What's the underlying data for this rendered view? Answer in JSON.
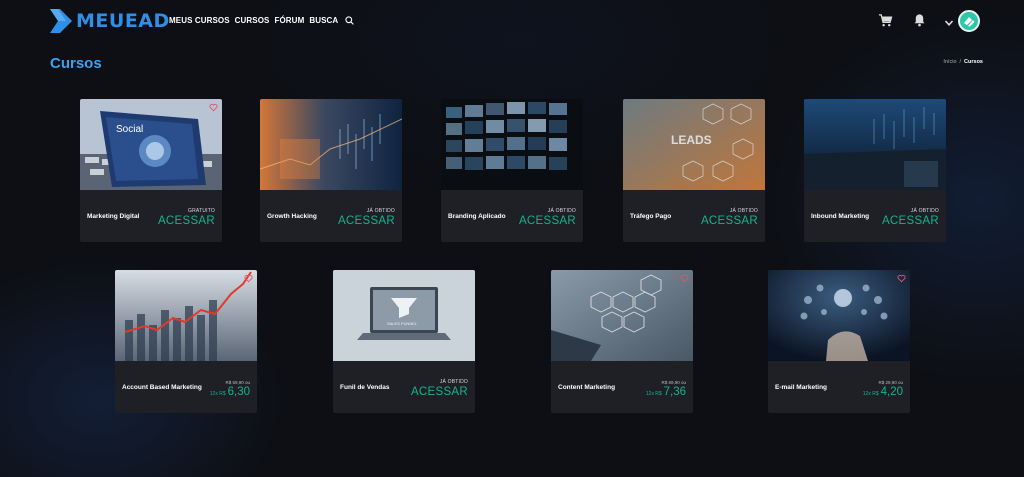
{
  "brand": {
    "name": "MEUEAD"
  },
  "nav": {
    "items": [
      "MEUS CURSOS",
      "CURSOS",
      "FÓRUM",
      "BUSCA"
    ]
  },
  "page": {
    "title": "Cursos",
    "breadcrumb": {
      "home": "Início",
      "separator": "/",
      "current": "Cursos"
    }
  },
  "colors": {
    "accent": "#3aa0f0",
    "green": "#15b38c",
    "card_bg": "#1e2026",
    "heart": "#e0566b"
  },
  "courses": [
    {
      "title": "Marketing Digital",
      "status": "GRATUITO",
      "action": "ACESSAR",
      "favorite": true
    },
    {
      "title": "Growth Hacking",
      "status": "JÁ OBTIDO",
      "action": "ACESSAR",
      "favorite": false
    },
    {
      "title": "Branding Aplicado",
      "status": "JÁ OBTIDO",
      "action": "ACESSAR",
      "favorite": false
    },
    {
      "title": "Tráfego Pago",
      "status": "JÁ OBTIDO",
      "action": "ACESSAR",
      "favorite": false
    },
    {
      "title": "Inbound Marketing",
      "status": "JÁ OBTIDO",
      "action": "ACESSAR",
      "favorite": false
    },
    {
      "title": "Account Based Marketing",
      "old_price": "R$ 59,90 ou",
      "installment_prefix": "12x R$",
      "installment_value": "6,30",
      "favorite": true
    },
    {
      "title": "Funil de Vendas",
      "status": "JÁ OBTIDO",
      "action": "ACESSAR",
      "favorite": false
    },
    {
      "title": "Content Marketing",
      "old_price": "R$ 69,90 ou",
      "installment_prefix": "12x R$",
      "installment_value": "7,36",
      "favorite": true
    },
    {
      "title": "E-mail Marketing",
      "old_price": "R$ 29,90 ou",
      "installment_prefix": "12x R$",
      "installment_value": "4,20",
      "favorite": true
    }
  ]
}
